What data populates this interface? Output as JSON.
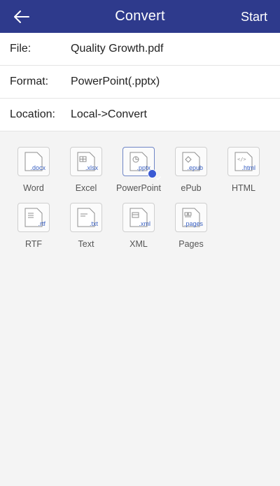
{
  "header": {
    "title": "Convert",
    "start_label": "Start",
    "bg_color": "#2e3a8c"
  },
  "info": {
    "file_label": "File:",
    "file_value": "Quality Growth.pdf",
    "format_label": "Format:",
    "format_value": "PowerPoint(.pptx)",
    "location_label": "Location:",
    "location_value": "Local->Convert"
  },
  "formats": [
    {
      "label": "Word",
      "ext": ".docx",
      "selected": false
    },
    {
      "label": "Excel",
      "ext": ".xlsx",
      "selected": false
    },
    {
      "label": "PowerPoint",
      "ext": ".pptx",
      "selected": true
    },
    {
      "label": "ePub",
      "ext": ".epub",
      "selected": false
    },
    {
      "label": "HTML",
      "ext": ".html",
      "selected": false
    },
    {
      "label": "RTF",
      "ext": ".rtf",
      "selected": false
    },
    {
      "label": "Text",
      "ext": ".txt",
      "selected": false
    },
    {
      "label": "XML",
      "ext": ".xml",
      "selected": false
    },
    {
      "label": "Pages",
      "ext": ".pages",
      "selected": false
    }
  ],
  "accent_color": "#3b5bd4"
}
